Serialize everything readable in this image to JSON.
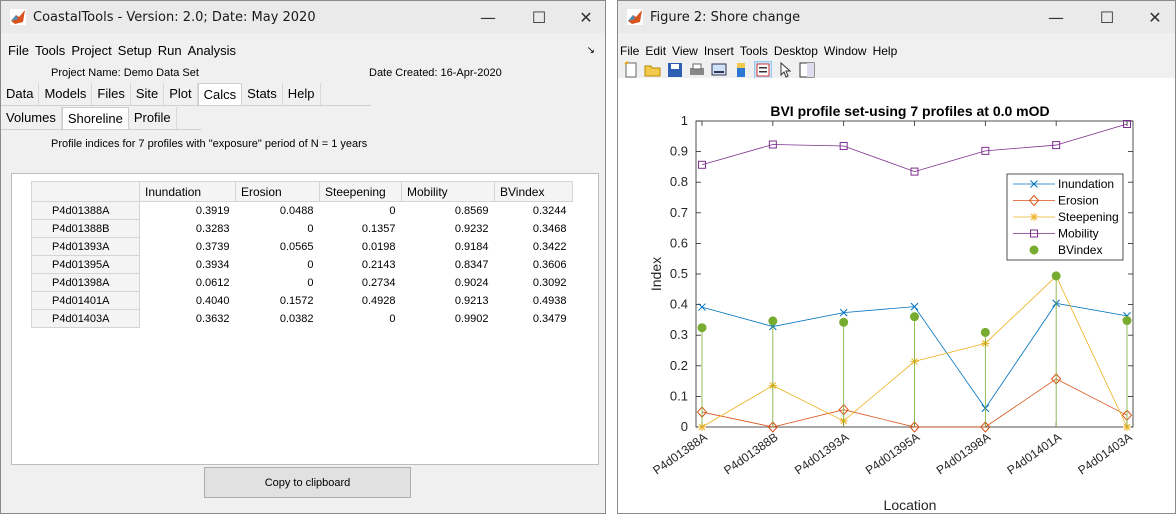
{
  "coastal": {
    "title": "CoastalTools - Version: 2.0;  Date: May 2020",
    "menu": [
      "File",
      "Tools",
      "Project",
      "Setup",
      "Run",
      "Analysis"
    ],
    "project_name_label": "Project Name: Demo Data Set",
    "date_created": "Date Created: 16-Apr-2020",
    "tabs": [
      "Data",
      "Models",
      "Files",
      "Site",
      "Plot",
      "Calcs",
      "Stats",
      "Help"
    ],
    "active_tab": "Calcs",
    "subtabs": [
      "Volumes",
      "Shoreline",
      "Profile"
    ],
    "active_subtab": "Shoreline",
    "description": "Profile indices for 7 profiles with \"exposure\" period of N = 1 years",
    "table": {
      "columns": [
        "Inundation",
        "Erosion",
        "Steepening",
        "Mobility",
        "BVindex"
      ],
      "rows": [
        {
          "name": "P4d01388A",
          "values": [
            "0.3919",
            "0.0488",
            "0",
            "0.8569",
            "0.3244"
          ]
        },
        {
          "name": "P4d01388B",
          "values": [
            "0.3283",
            "0",
            "0.1357",
            "0.9232",
            "0.3468"
          ]
        },
        {
          "name": "P4d01393A",
          "values": [
            "0.3739",
            "0.0565",
            "0.0198",
            "0.9184",
            "0.3422"
          ]
        },
        {
          "name": "P4d01395A",
          "values": [
            "0.3934",
            "0",
            "0.2143",
            "0.8347",
            "0.3606"
          ]
        },
        {
          "name": "P4d01398A",
          "values": [
            "0.0612",
            "0",
            "0.2734",
            "0.9024",
            "0.3092"
          ]
        },
        {
          "name": "P4d01401A",
          "values": [
            "0.4040",
            "0.1572",
            "0.4928",
            "0.9213",
            "0.4938"
          ]
        },
        {
          "name": "P4d01403A",
          "values": [
            "0.3632",
            "0.0382",
            "0",
            "0.9902",
            "0.3479"
          ]
        }
      ]
    },
    "copy_button": "Copy to clipboard"
  },
  "figure": {
    "title": "Figure 2: Shore change",
    "menu": [
      "File",
      "Edit",
      "View",
      "Insert",
      "Tools",
      "Desktop",
      "Window",
      "Help"
    ],
    "toolbar_icons": [
      "new-file-icon",
      "open-folder-icon",
      "save-icon",
      "print-icon",
      "link-plot-icon",
      "colorbar-icon",
      "legend-icon",
      "pointer-icon",
      "property-editor-icon"
    ]
  },
  "chart_data": {
    "type": "line",
    "title": "BVI profile set-using 7 profiles at 0.0 mOD",
    "xlabel": "Location",
    "ylabel": "Index",
    "categories": [
      "P4d01388A",
      "P4d01388B",
      "P4d01393A",
      "P4d01395A",
      "P4d01398A",
      "P4d01401A",
      "P4d01403A"
    ],
    "ylim": [
      0,
      1
    ],
    "yticks": [
      "0",
      "0.1",
      "0.2",
      "0.3",
      "0.4",
      "0.5",
      "0.6",
      "0.7",
      "0.8",
      "0.9",
      "1"
    ],
    "legend_position": "top-right",
    "series": [
      {
        "name": "Inundation",
        "marker": "x",
        "color": "#0072bd",
        "values": [
          0.3919,
          0.3283,
          0.3739,
          0.3934,
          0.0612,
          0.404,
          0.3632
        ]
      },
      {
        "name": "Erosion",
        "marker": "diamond",
        "color": "#d95319",
        "values": [
          0.0488,
          0,
          0.0565,
          0,
          0,
          0.1572,
          0.0382
        ]
      },
      {
        "name": "Steepening",
        "marker": "star",
        "color": "#edb120",
        "values": [
          0,
          0.1357,
          0.0198,
          0.2143,
          0.2734,
          0.4928,
          0
        ]
      },
      {
        "name": "Mobility",
        "marker": "square",
        "color": "#7e2f8e",
        "values": [
          0.8569,
          0.9232,
          0.9184,
          0.8347,
          0.9024,
          0.9213,
          0.9902
        ]
      },
      {
        "name": "BVindex",
        "marker": "stem",
        "color": "#77ac30",
        "values": [
          0.3244,
          0.3468,
          0.3422,
          0.3606,
          0.3092,
          0.4938,
          0.3479
        ]
      }
    ]
  }
}
